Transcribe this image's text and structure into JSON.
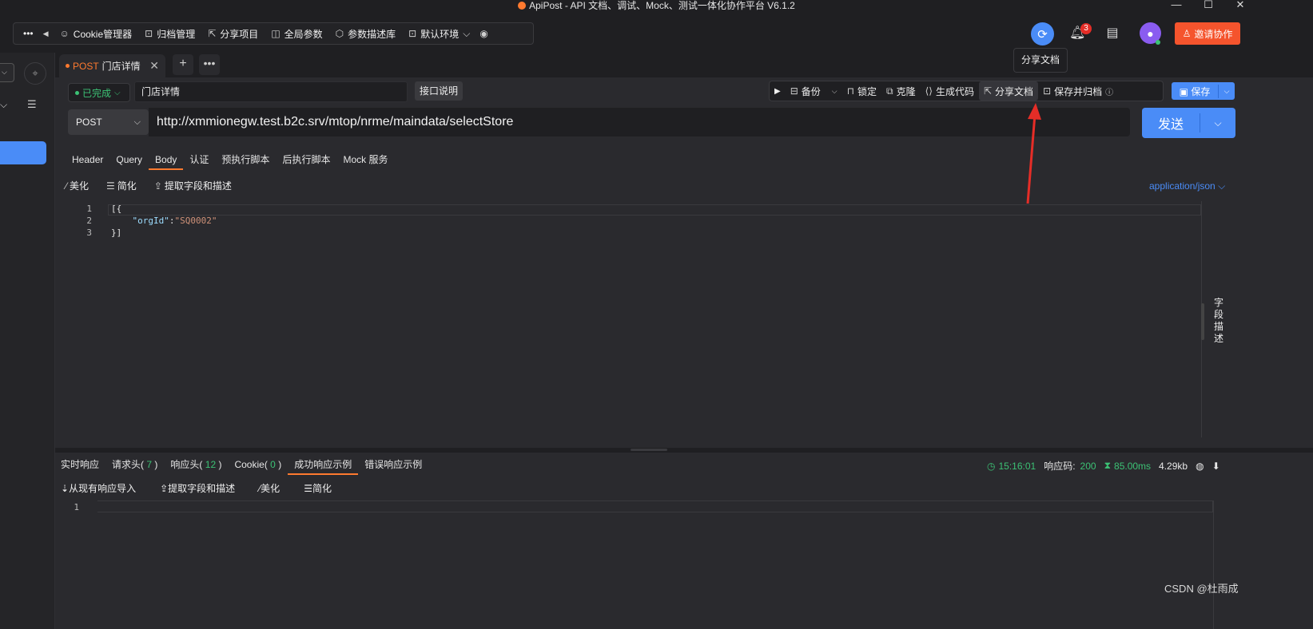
{
  "window": {
    "title": "ApiPost - API 文档、调试、Mock、测试一体化协作平台 V6.1.2",
    "controls": [
      "—",
      "☐",
      "✕"
    ]
  },
  "toolbar": {
    "more": "•••",
    "back": "◀",
    "items": [
      {
        "icon": "cookie-icon",
        "label": "Cookie管理器"
      },
      {
        "icon": "archive-icon",
        "label": "归档管理"
      },
      {
        "icon": "share-icon",
        "label": "分享项目"
      },
      {
        "icon": "params-icon",
        "label": "全局参数"
      },
      {
        "icon": "cube-icon",
        "label": "参数描述库"
      },
      {
        "icon": "env-icon",
        "label": "默认环境"
      }
    ]
  },
  "header_right": {
    "notification_count": "3",
    "invite_label": "邀请协作",
    "tooltip": "分享文档"
  },
  "tab": {
    "method": "POST",
    "name": "门店详情",
    "close": "✕",
    "add": "+",
    "more": "•••"
  },
  "request": {
    "status": "已完成",
    "name": "门店详情",
    "doc_button": "接口说明",
    "actions": [
      "备份",
      "锁定",
      "克隆",
      "生成代码",
      "分享文档",
      "保存并归档"
    ],
    "save_label": "保存",
    "method": "POST",
    "url": "http://xmmionegw.test.b2c.srv/mtop/nrme/maindata/selectStore",
    "send_label": "发送"
  },
  "request_tabs": [
    "Header",
    "Query",
    "Body",
    "认证",
    "预执行脚本",
    "后执行脚本",
    "Mock 服务"
  ],
  "body_tools": [
    "美化",
    "简化",
    "提取字段和描述"
  ],
  "content_type": "application/json",
  "editor": {
    "line_numbers": [
      "1",
      "2",
      "3"
    ],
    "lines": {
      "l1": "[{",
      "l2_key": "\"orgId\"",
      "l2_colon": ":",
      "l2_val": "\"SQ0002\"",
      "l3": "}]"
    }
  },
  "side_panel": {
    "field_desc": "字段描述"
  },
  "response": {
    "tabs": [
      {
        "label": "实时响应",
        "count": ""
      },
      {
        "label": "请求头",
        "count": "7"
      },
      {
        "label": "响应头",
        "count": "12"
      },
      {
        "label": "Cookie",
        "count": "0"
      },
      {
        "label": "成功响应示例",
        "count": ""
      },
      {
        "label": "错误响应示例",
        "count": ""
      }
    ],
    "time": "15:16:01",
    "code_label": "响应码:",
    "code": "200",
    "duration": "85.00ms",
    "size": "4.29kb",
    "tools": [
      "从现有响应导入",
      "提取字段和描述",
      "美化",
      "简化"
    ],
    "line_number": "1"
  },
  "watermark": "CSDN @杜雨成",
  "colors": {
    "accent": "#4a8cf7",
    "orange": "#ff7a2f",
    "success": "#3cc275",
    "arrow": "#e52d27"
  }
}
